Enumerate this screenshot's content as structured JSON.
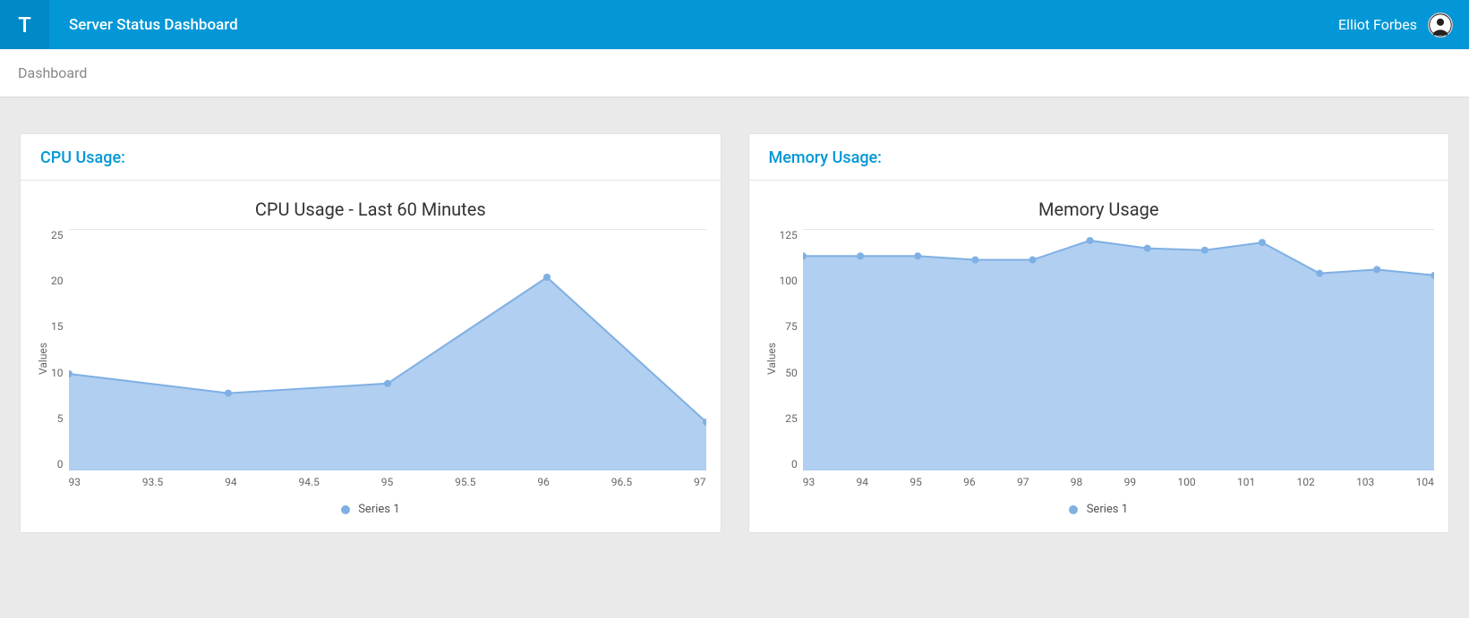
{
  "header": {
    "logo_letter": "T",
    "title": "Server Status Dashboard",
    "user_name": "Elliot Forbes"
  },
  "breadcrumb": {
    "label": "Dashboard"
  },
  "panels": {
    "cpu": {
      "heading": "CPU Usage:",
      "chart_title": "CPU Usage - Last 60 Minutes",
      "y_label": "Values",
      "legend": "Series 1"
    },
    "memory": {
      "heading": "Memory Usage:",
      "chart_title": "Memory Usage",
      "y_label": "Values",
      "legend": "Series 1"
    }
  },
  "colors": {
    "accent": "#0397d7",
    "series_fill": "#a3c7ed",
    "series_stroke": "#7fb0e4"
  },
  "chart_data": [
    {
      "id": "cpu",
      "type": "area",
      "title": "CPU Usage - Last 60 Minutes",
      "xlabel": "",
      "ylabel": "Values",
      "x": [
        93,
        94,
        95,
        96,
        97
      ],
      "series": [
        {
          "name": "Series 1",
          "values": [
            10,
            8,
            9,
            20,
            5
          ]
        }
      ],
      "x_ticks": [
        93,
        93.5,
        94,
        94.5,
        95,
        95.5,
        96,
        96.5,
        97
      ],
      "y_ticks": [
        25,
        20,
        15,
        10,
        5,
        0
      ],
      "xlim": [
        93,
        97
      ],
      "ylim": [
        0,
        25
      ]
    },
    {
      "id": "memory",
      "type": "area",
      "title": "Memory Usage",
      "xlabel": "",
      "ylabel": "Values",
      "x": [
        93,
        94,
        95,
        96,
        97,
        98,
        99,
        100,
        101,
        102,
        103,
        104
      ],
      "series": [
        {
          "name": "Series 1",
          "values": [
            111,
            111,
            111,
            109,
            109,
            119,
            115,
            114,
            118,
            102,
            104,
            101
          ]
        }
      ],
      "x_ticks": [
        93,
        94,
        95,
        96,
        97,
        98,
        99,
        100,
        101,
        102,
        103,
        104
      ],
      "y_ticks": [
        125,
        100,
        75,
        50,
        25,
        0
      ],
      "xlim": [
        93,
        104
      ],
      "ylim": [
        0,
        125
      ]
    }
  ]
}
